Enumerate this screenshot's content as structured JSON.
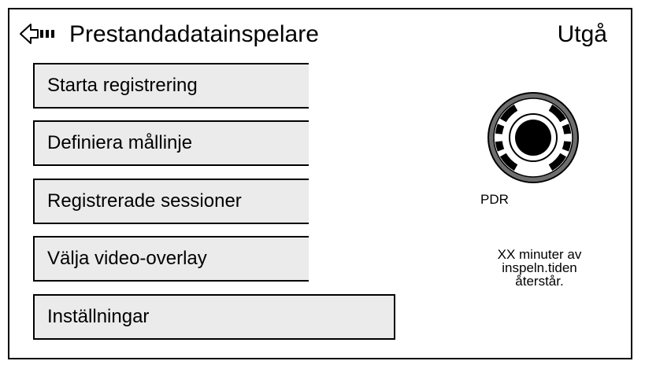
{
  "header": {
    "title": "Prestandadatainspelare",
    "exit_label": "Utgå"
  },
  "menu": {
    "items": [
      {
        "label": "Starta registrering"
      },
      {
        "label": "Definiera mållinje"
      },
      {
        "label": "Registrerade sessioner"
      },
      {
        "label": "Välja video-overlay"
      },
      {
        "label": "Inställningar",
        "selected": true
      }
    ]
  },
  "status": {
    "pdr_label": "PDR",
    "remaining_line1": "XX minuter av",
    "remaining_line2": "inspeln.tiden",
    "remaining_line3": "återstår."
  },
  "icons": {
    "back": "back-arrow-icon",
    "dial": "recorder-dial-icon"
  },
  "colors": {
    "button_fill": "#ebebeb",
    "border": "#000000",
    "background": "#ffffff"
  }
}
